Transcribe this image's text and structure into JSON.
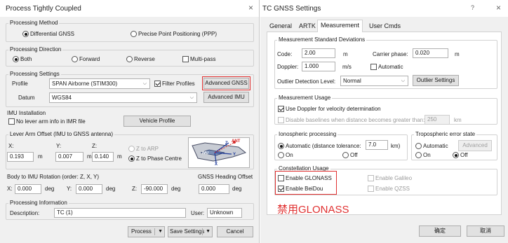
{
  "left_window": {
    "title": "Process Tightly Coupled",
    "close_glyph": "×",
    "processing_method": {
      "label": "Processing Method",
      "options": [
        "Differential GNSS",
        "Precise Point Positioning (PPP)"
      ],
      "selected": "Differential GNSS"
    },
    "processing_direction": {
      "label": "Processing Direction",
      "options": [
        "Both",
        "Forward",
        "Reverse"
      ],
      "selected": "Both",
      "multipass_label": "Multi-pass",
      "multipass_checked": false
    },
    "processing_settings": {
      "label": "Processing Settings",
      "profile_label": "Profile",
      "profile_value": "SPAN Airborne (STIM300)",
      "filter_profiles_label": "Filter Profiles",
      "filter_profiles_checked": true,
      "advanced_gnss_label": "Advanced GNSS",
      "datum_label": "Datum",
      "datum_value": "WGS84",
      "advanced_imu_label": "Advanced IMU"
    },
    "imu_installation": {
      "label": "IMU Installation",
      "no_lever_arm_label": "No lever arm info in IMR file",
      "no_lever_arm_checked": false,
      "vehicle_profile_label": "Vehicle Profile"
    },
    "lever_arm": {
      "label": "Lever Arm Offset (IMU to GNSS antenna)",
      "x_label": "X:",
      "y_label": "Y:",
      "z_label": "Z:",
      "x_value": "0.193",
      "y_value": "0.007",
      "z_value": "0.140",
      "unit": "m",
      "option_arp": "Z to ARP",
      "option_phase": "Z to Phase Centre",
      "selected": "Z to Phase Centre",
      "diagram": {
        "ant": "ANT",
        "imu": "IMU",
        "z": "Z",
        "y": "Y",
        "x": "X"
      }
    },
    "body_to_imu": {
      "label": "Body to IMU Rotation (order: Z, X, Y)",
      "x_label": "X:",
      "y_label": "Y:",
      "z_label": "Z:",
      "x_value": "0.000",
      "y_value": "0.000",
      "z_value": "-90.000",
      "unit": "deg"
    },
    "heading_offset": {
      "label": "GNSS Heading Offset",
      "value": "0.000",
      "unit": "deg"
    },
    "processing_information": {
      "label": "Processing Information",
      "description_label": "Description:",
      "description_value": "TC (1)",
      "user_label": "User:",
      "user_value": "Unknown"
    },
    "footer": {
      "process_label": "Process",
      "save_settings_label": "Save Settings",
      "cancel_label": "Cancel"
    }
  },
  "right_window": {
    "title": "TC GNSS Settings",
    "help_glyph": "?",
    "close_glyph": "×",
    "tabs": [
      "General",
      "ARTK",
      "Measurement",
      "User Cmds"
    ],
    "active_tab": "Measurement",
    "std_dev": {
      "label": "Measurement Standard Deviations",
      "code_label": "Code:",
      "code_value": "2.00",
      "code_unit": "m",
      "carrier_label": "Carrier phase:",
      "carrier_value": "0.020",
      "carrier_unit": "m",
      "doppler_label": "Doppler:",
      "doppler_value": "1.000",
      "doppler_unit": "m/s",
      "automatic_label": "Automatic",
      "automatic_checked": false,
      "outlier_label": "Outlier Detection Level:",
      "outlier_value": "Normal",
      "outlier_settings_label": "Outlier Settings"
    },
    "usage": {
      "label": "Measurement Usage",
      "use_doppler_label": "Use Doppler for velocity determination",
      "use_doppler_checked": true,
      "disable_baselines_label": "Disable baselines when distance becomes greater than:",
      "disable_baselines_checked": false,
      "distance_value": "250",
      "distance_unit": "km"
    },
    "iono": {
      "label": "Ionospheric processing",
      "automatic_label": "Automatic (distance tolerance:",
      "tolerance_value": "7.0",
      "tolerance_unit": "km)",
      "on_label": "On",
      "off_label": "Off",
      "selected": "Automatic"
    },
    "tropo": {
      "label": "Tropospheric error state",
      "automatic_label": "Automatic",
      "advanced_label": "Advanced",
      "on_label": "On",
      "off_label": "Off",
      "selected": "Off"
    },
    "constellation": {
      "label": "Constellation Usage",
      "glonass_label": "Enable GLONASS",
      "glonass_checked": false,
      "beidou_label": "Enable BeiDou",
      "beidou_checked": true,
      "galileo_label": "Enable Galileo",
      "galileo_checked": false,
      "qzss_label": "Enable QZSS",
      "qzss_checked": false
    },
    "annotation_text": "禁用GLONASS",
    "footer": {
      "ok_label": "确定",
      "cancel_label": "取消"
    }
  },
  "colors": {
    "window_bg": "#f0f0f0",
    "highlight_red": "#e03030",
    "tab_panel_bg": "#ffffff",
    "button_bg": "#e1e1e1"
  }
}
